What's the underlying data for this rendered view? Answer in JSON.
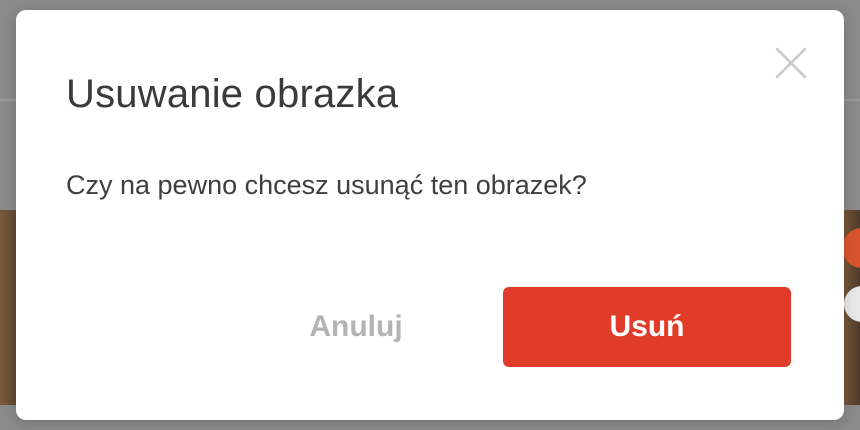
{
  "dialog": {
    "title": "Usuwanie obrazka",
    "message": "Czy na pewno chcesz usunąć ten obrazek?",
    "cancel_label": "Anuluj",
    "confirm_label": "Usuń",
    "close_icon": "close-icon"
  },
  "colors": {
    "confirm_button": "#e13c2a",
    "cancel_text": "#b3b3b3",
    "title_text": "#3a3a3a"
  }
}
